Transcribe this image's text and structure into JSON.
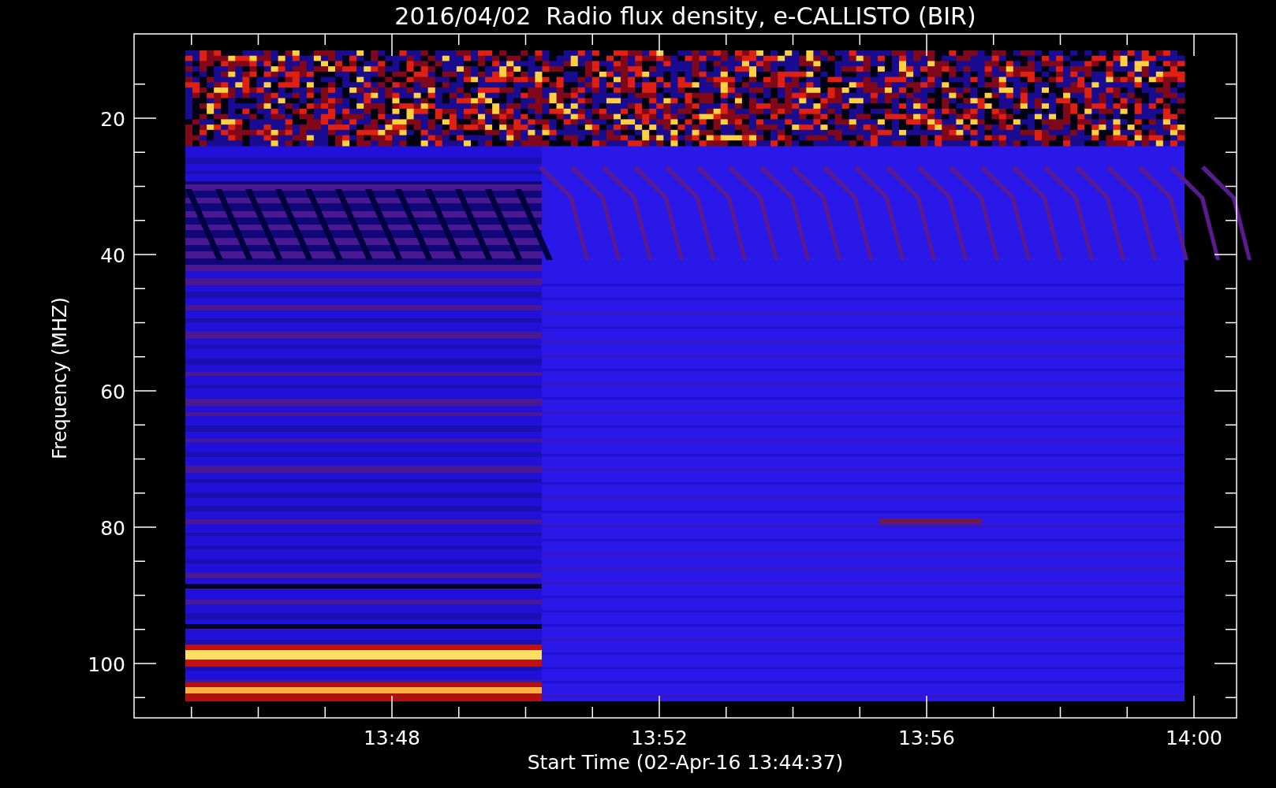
{
  "title": "2016/04/02  Radio flux density, e-CALLISTO (BIR)",
  "y_axis": {
    "label": "Frequency (MHZ)",
    "tick_labels": [
      "20",
      "40",
      "60",
      "80",
      "100"
    ]
  },
  "x_axis": {
    "label": "Start Time (02-Apr-16 13:44:37)",
    "tick_labels": [
      "13:48",
      "13:52",
      "13:56",
      "14:00"
    ]
  }
}
